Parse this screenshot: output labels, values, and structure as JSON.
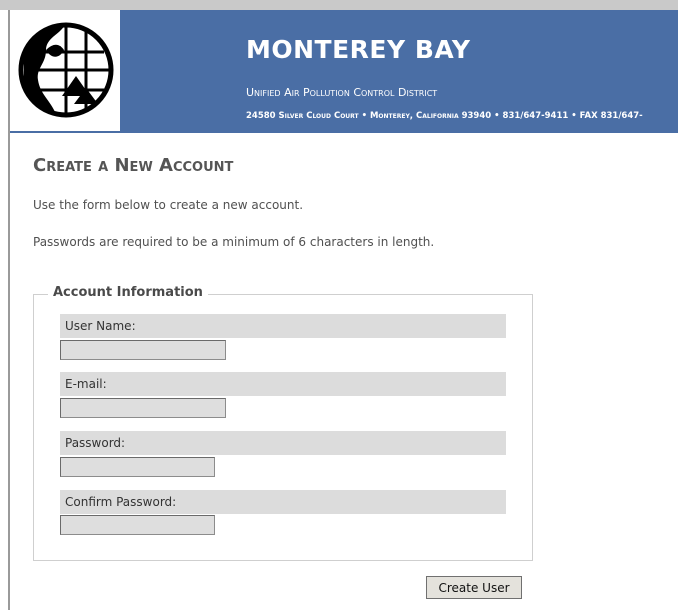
{
  "header": {
    "title": "MONTEREY BAY",
    "subtitle": "Unified Air Pollution Control District",
    "address": "24580 Silver Cloud Court • Monterey, California 93940 • 831/647-9411 • FAX 831/647-"
  },
  "page": {
    "title": "Create a New Account",
    "intro": "Use the form below to create a new account.",
    "password_note": "Passwords are required to be a minimum of 6 characters in length."
  },
  "form": {
    "legend": "Account Information",
    "fields": [
      {
        "label": "User Name:",
        "value": ""
      },
      {
        "label": "E-mail:",
        "value": ""
      },
      {
        "label": "Password:",
        "value": ""
      },
      {
        "label": "Confirm Password:",
        "value": ""
      }
    ],
    "submit_label": "Create User"
  },
  "colors": {
    "header_bg": "#4a6ea5",
    "label_bar_bg": "#dcdcdc"
  },
  "icons": {
    "logo": "globe-logo-icon"
  }
}
